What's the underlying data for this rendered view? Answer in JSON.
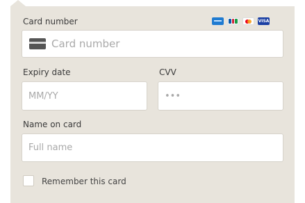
{
  "card_number": {
    "label": "Card number",
    "placeholder": "Card number",
    "generic_card_icon": "credit-card-icon",
    "brands": [
      "amex-icon",
      "jcb-icon",
      "mastercard-icon",
      "visa-icon"
    ],
    "visa_text": "VISA"
  },
  "expiry": {
    "label": "Expiry date",
    "placeholder": "MM/YY"
  },
  "cvv": {
    "label": "CVV",
    "placeholder": "•••"
  },
  "name": {
    "label": "Name on card",
    "placeholder": "Full name"
  },
  "remember": {
    "label": "Remember this card",
    "checked": false
  },
  "colors": {
    "panel_bg": "#e8e4dc",
    "field_bg": "#ffffff",
    "field_border": "#d6d2ca",
    "text": "#3a3a3a",
    "placeholder": "#a9a9a9"
  }
}
